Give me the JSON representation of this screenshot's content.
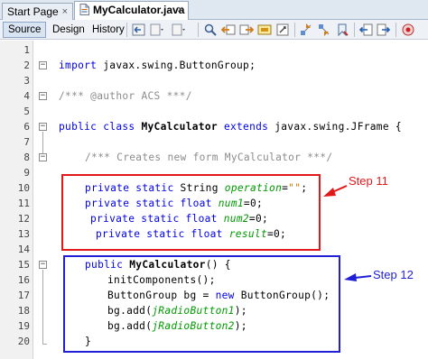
{
  "tabs": [
    {
      "label": "Start Page",
      "close": "×"
    },
    {
      "label": "MyCalculator.java",
      "close": "×"
    }
  ],
  "toolbar": {
    "source_label": "Source",
    "design_label": "Design",
    "history_label": "History"
  },
  "lines": [
    {
      "num": "1"
    },
    {
      "num": "2"
    },
    {
      "num": "3"
    },
    {
      "num": "4"
    },
    {
      "num": "5"
    },
    {
      "num": "6"
    },
    {
      "num": "7"
    },
    {
      "num": "8"
    },
    {
      "num": "9"
    },
    {
      "num": "10"
    },
    {
      "num": "11"
    },
    {
      "num": "12"
    },
    {
      "num": "13"
    },
    {
      "num": "14"
    },
    {
      "num": "15"
    },
    {
      "num": "16"
    },
    {
      "num": "17"
    },
    {
      "num": "18"
    },
    {
      "num": "19"
    },
    {
      "num": "20"
    }
  ],
  "code": {
    "l2_kw": "import",
    "l2_rest": " javax.swing.ButtonGroup;",
    "l4": "/*** @author ACS ***/",
    "l6_kw": "public class",
    "l6_name": " MyCalculator",
    "l6_ext": " extends",
    "l6_rest": " javax.swing.JFrame {",
    "l8": "/*** Creates new form MyCalculator ***/",
    "l10_kw": "private static",
    "l10_type": " String ",
    "l10_field": "operation",
    "l10_eq": "=",
    "l10_str": "\"\"",
    "l10_end": ";",
    "l11_kw": "private static float",
    "l11_field": "num1",
    "l11_end": "=0;",
    "l12_kw": "private static float",
    "l12_field": "num2",
    "l12_end": "=0;",
    "l13_kw": "private static float",
    "l13_field": "result",
    "l13_end": "=0;",
    "l15_kw": "public",
    "l15_name": " MyCalculator",
    "l15_rest": "() {",
    "l16": "initComponents();",
    "l17_a": "ButtonGroup bg = ",
    "l17_kw": "new",
    "l17_b": " ButtonGroup();",
    "l18_a": "bg.add(",
    "l18_field": "jRadioButton1",
    "l18_b": ");",
    "l19_a": "bg.add(",
    "l19_field": "jRadioButton2",
    "l19_b": ");",
    "l20": "}"
  },
  "annotations": {
    "step11": "Step 11",
    "step12": "Step 12",
    "red": "#e11919",
    "blue": "#1f1fd6"
  },
  "icons": [
    "back-icon",
    "forward-dropdown-icon",
    "history-dropdown-icon",
    "find-icon",
    "find-previous-icon",
    "find-next-icon",
    "find-selection-icon",
    "toggle-highlight-icon",
    "previous-bookmark-icon",
    "next-bookmark-icon",
    "toggle-bookmark-icon",
    "shift-left-icon",
    "shift-right-icon",
    "macro-icon"
  ]
}
